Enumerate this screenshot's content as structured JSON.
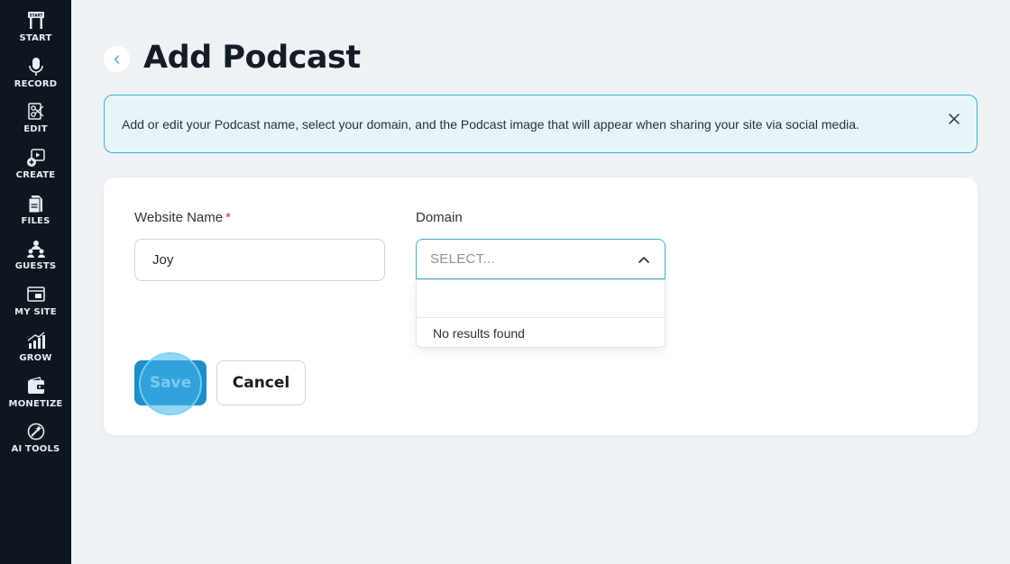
{
  "sidebar": {
    "items": [
      {
        "label": "START",
        "icon": "start-icon"
      },
      {
        "label": "RECORD",
        "icon": "microphone-icon"
      },
      {
        "label": "EDIT",
        "icon": "edit-icon"
      },
      {
        "label": "CREATE",
        "icon": "create-icon"
      },
      {
        "label": "FILES",
        "icon": "files-icon"
      },
      {
        "label": "GUESTS",
        "icon": "guests-icon"
      },
      {
        "label": "MY SITE",
        "icon": "my-site-icon"
      },
      {
        "label": "GROW",
        "icon": "grow-icon"
      },
      {
        "label": "MONETIZE",
        "icon": "monetize-icon"
      },
      {
        "label": "AI TOOLS",
        "icon": "ai-tools-icon"
      }
    ]
  },
  "header": {
    "title": "Add Podcast"
  },
  "banner": {
    "text": "Add or edit your Podcast name, select your domain, and the Podcast image that will appear when sharing your site via social media."
  },
  "form": {
    "website_name_label": "Website Name",
    "required_marker": "*",
    "website_name_value": "Joy",
    "domain_label": "Domain",
    "domain_placeholder": "SELECT...",
    "dropdown_search_value": "",
    "dropdown_empty_text": "No results found",
    "save_label": "Save",
    "cancel_label": "Cancel"
  },
  "colors": {
    "sidebar_bg": "#0e1620",
    "page_bg": "#eef2f7",
    "accent": "#3fb0c2",
    "primary_button": "#1f8dc7",
    "required": "#d12b2b"
  }
}
